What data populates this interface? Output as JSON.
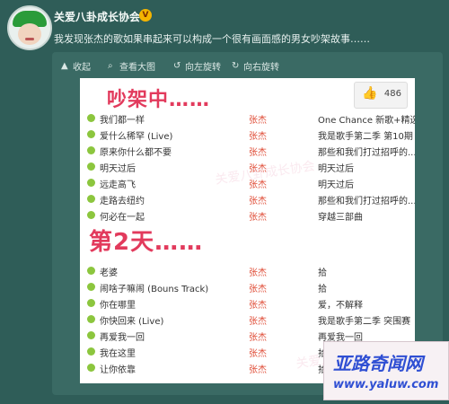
{
  "post": {
    "account_name": "关爱八卦成长协会",
    "badge": "V",
    "text": "我发现张杰的歌如果串起来可以构成一个很有画面感的男女吵架故事……"
  },
  "toolbar": {
    "collapse": "收起",
    "view_large": "查看大图",
    "rotate_left": "向左旋转",
    "rotate_right": "向右旋转"
  },
  "image": {
    "heading1": "吵架中……",
    "heading2": "第2天……",
    "likes": "486",
    "watermark": "关爱八卦成长协会",
    "section1": [
      {
        "song": "我们都一样",
        "artist": "张杰",
        "album": "One Chance 新歌+精选"
      },
      {
        "song": "爱什么稀罕 (Live)",
        "artist": "张杰",
        "album": "我是歌手第二季 第10期"
      },
      {
        "song": "原来你什么都不要",
        "artist": "张杰",
        "album": "那些和我们打过招呼的..."
      },
      {
        "song": "明天过后",
        "artist": "张杰",
        "album": "明天过后"
      },
      {
        "song": "远走高飞",
        "artist": "张杰",
        "album": "明天过后"
      },
      {
        "song": "走路去纽约",
        "artist": "张杰",
        "album": "那些和我们打过招呼的..."
      },
      {
        "song": "何必在一起",
        "artist": "张杰",
        "album": "穿越三部曲"
      }
    ],
    "section2": [
      {
        "song": "老婆",
        "artist": "张杰",
        "album": "拾"
      },
      {
        "song": "闹啥子嘛闹 (Bouns Track)",
        "artist": "张杰",
        "album": "拾"
      },
      {
        "song": "你在哪里",
        "artist": "张杰",
        "album": "爱，不解释"
      },
      {
        "song": "你快回来 (Live)",
        "artist": "张杰",
        "album": "我是歌手第二季 突围赛"
      },
      {
        "song": "再爱我一回",
        "artist": "张杰",
        "album": "再爱我一回"
      },
      {
        "song": "我在这里",
        "artist": "张杰",
        "album": "拾"
      },
      {
        "song": "让你依靠",
        "artist": "张杰",
        "album": "拾"
      }
    ]
  },
  "site_logo": {
    "name": "亚路奇闻网",
    "url": "www.yaluw.com"
  }
}
